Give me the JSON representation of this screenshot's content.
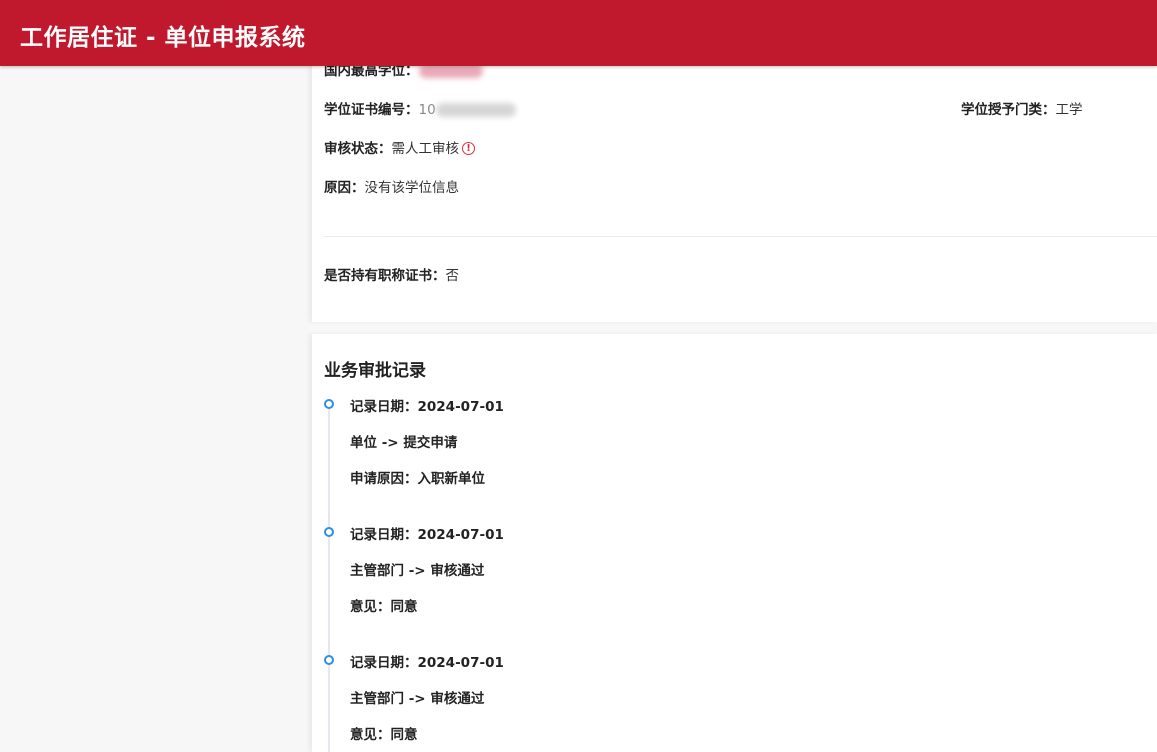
{
  "header": {
    "title": "工作居住证 - 单位申报系统"
  },
  "info": {
    "highest_degree_label": "国内最高学位：",
    "degree_cert_no_label": "学位证书编号：",
    "degree_cert_no_prefix": "10",
    "degree_category_label": "学位授予门类：",
    "degree_category_value": "工学",
    "review_status_label": "审核状态：",
    "review_status_value": "需人工审核",
    "reason_label": "原因：",
    "reason_value": "没有该学位信息",
    "title_cert_label": "是否持有职称证书：",
    "title_cert_value": "否"
  },
  "records": {
    "title": "业务审批记录",
    "items": [
      {
        "date": "记录日期：2024-07-01",
        "action": "单位 -> 提交申请",
        "note": "申请原因：入职新单位"
      },
      {
        "date": "记录日期：2024-07-01",
        "action": "主管部门 -> 审核通过",
        "note": "意见：同意"
      },
      {
        "date": "记录日期：2024-07-01",
        "action": "主管部门 -> 审核通过",
        "note": "意见：同意"
      }
    ]
  },
  "colors": {
    "header_bg": "#c0192d",
    "timeline_dot": "#2f8ee0",
    "warning": "#d9303e"
  },
  "icons": {
    "warning": "exclamation-circle-icon",
    "timeline": "timeline-dot-icon"
  }
}
